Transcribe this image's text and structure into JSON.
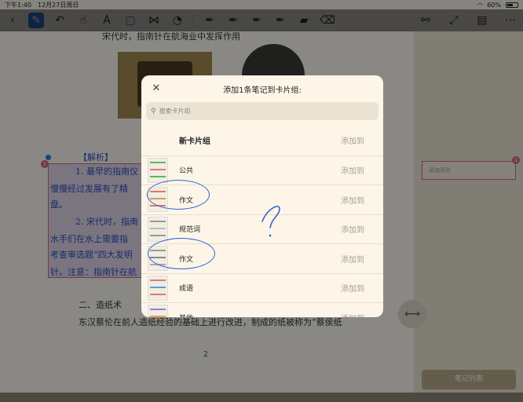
{
  "status_bar": {
    "time": "下午1:40",
    "date": "12月27日周日",
    "battery": "60%",
    "battery_level": 0.6
  },
  "toolbar": {
    "left_icons": [
      "back-icon",
      "pen-icon",
      "undo-icon",
      "redo-icon",
      "hand-icon",
      "text-icon",
      "select-rect-icon",
      "lasso-icon",
      "shapes-icon"
    ],
    "pen_colors": [
      "#8a2bd6",
      "#2f62d8",
      "#2aa34a",
      "#d42a2a"
    ],
    "right_icons": [
      "share-icon",
      "fullscreen-icon",
      "save-icon",
      "more-icon"
    ]
  },
  "page": {
    "top_line": "宋代时，指南针在航海业中发挥作用",
    "analysis_title": "【解析】",
    "analysis_lines": [
      "1. 最早的指南仪",
      "慢慢经过发展有了精",
      "盘。",
      "2. 宋代时，指南",
      "水手们在水上需要指",
      "考查审选题“四大发明",
      "针。注意：指南针在航"
    ],
    "section_heading": "二、造纸术",
    "body_line": "东汉蔡伦在前人造纸经验的基础上进行改进，制成的纸被称为“蔡侯纸",
    "page_number": "2",
    "marker_number": "1"
  },
  "sidebar": {
    "comment_placeholder": "添加评论",
    "comment_badge": "1",
    "notes_list_button": "笔记列表"
  },
  "modal": {
    "title": "添加1条笔记到卡片组:",
    "search_placeholder": "搜索卡片组",
    "rows": [
      {
        "name": "新卡片组",
        "action": "添加到",
        "bold": true
      },
      {
        "name": "公共",
        "action": "添加到",
        "thumb_colors": [
          "#5cb85c",
          "#e07a7a",
          "#5cb85c"
        ]
      },
      {
        "name": "作文",
        "action": "添加到",
        "thumb_colors": [
          "#e07a5a",
          "#c9a060",
          "#e07a5a"
        ]
      },
      {
        "name": "规范词",
        "action": "添加到",
        "thumb_colors": [
          "#999999",
          "#bbbbbb",
          "#999999"
        ]
      },
      {
        "name": "作文",
        "action": "添加到",
        "thumb_colors": [
          "#999999",
          "#888888",
          "#aaaaaa"
        ]
      },
      {
        "name": "成语",
        "action": "添加到",
        "thumb_colors": [
          "#e07a7a",
          "#5c9be0",
          "#e07a7a"
        ]
      },
      {
        "name": "其他",
        "action": "添加到",
        "thumb_colors": [
          "#a07ad6",
          "#e0a05a",
          "#a07ad6"
        ]
      }
    ]
  },
  "annotation_color": "#2f62d8"
}
